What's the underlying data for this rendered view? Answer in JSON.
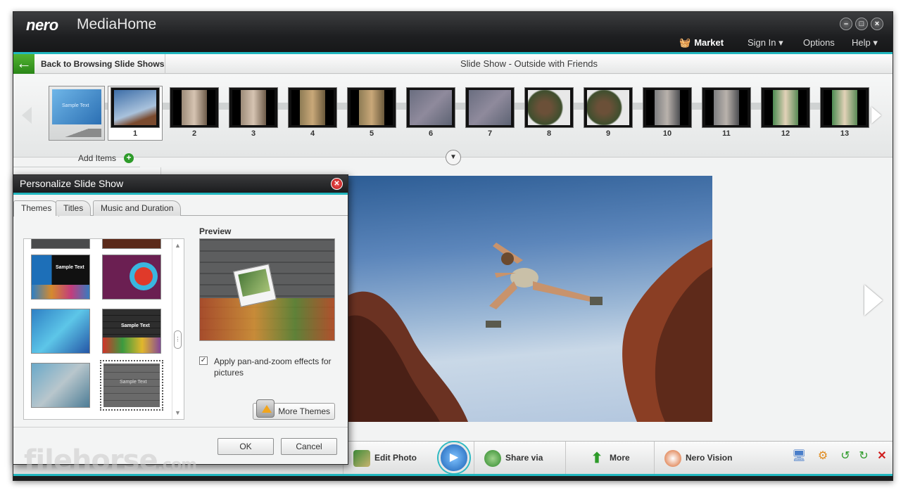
{
  "titlebar": {
    "logo": "nero",
    "app_name": "MediaHome",
    "market": "Market",
    "sign_in": "Sign In ▾",
    "options": "Options",
    "help": "Help ▾"
  },
  "nav": {
    "back_label": "Back to Browsing Slide Shows",
    "title": "Slide Show - Outside with Friends"
  },
  "strip": {
    "theme_caption": "Sample Text",
    "thumbnails": [
      "1",
      "2",
      "3",
      "4",
      "5",
      "6",
      "7",
      "8",
      "9",
      "10",
      "11",
      "12",
      "13"
    ],
    "add_items": "Add Items"
  },
  "toolbar": {
    "edit_photo": "Edit Photo",
    "share_via": "Share via",
    "more": "More",
    "nero_vision": "Nero Vision"
  },
  "dialog": {
    "title": "Personalize Slide Show",
    "tabs": [
      "Themes",
      "Titles",
      "Music and Duration"
    ],
    "active_tab": "Themes",
    "preview_label": "Preview",
    "pan_zoom_label": "Apply pan-and-zoom effects for pictures",
    "pan_zoom_checked": true,
    "more_themes": "More Themes",
    "ok": "OK",
    "cancel": "Cancel",
    "tile_text": "Sample Text"
  },
  "watermark": {
    "text": "filehorse",
    "suffix": ".com"
  },
  "colors": {
    "accent": "#21b7bf",
    "back_green": "#3a9e22",
    "titlebar": "#1e1f21"
  }
}
